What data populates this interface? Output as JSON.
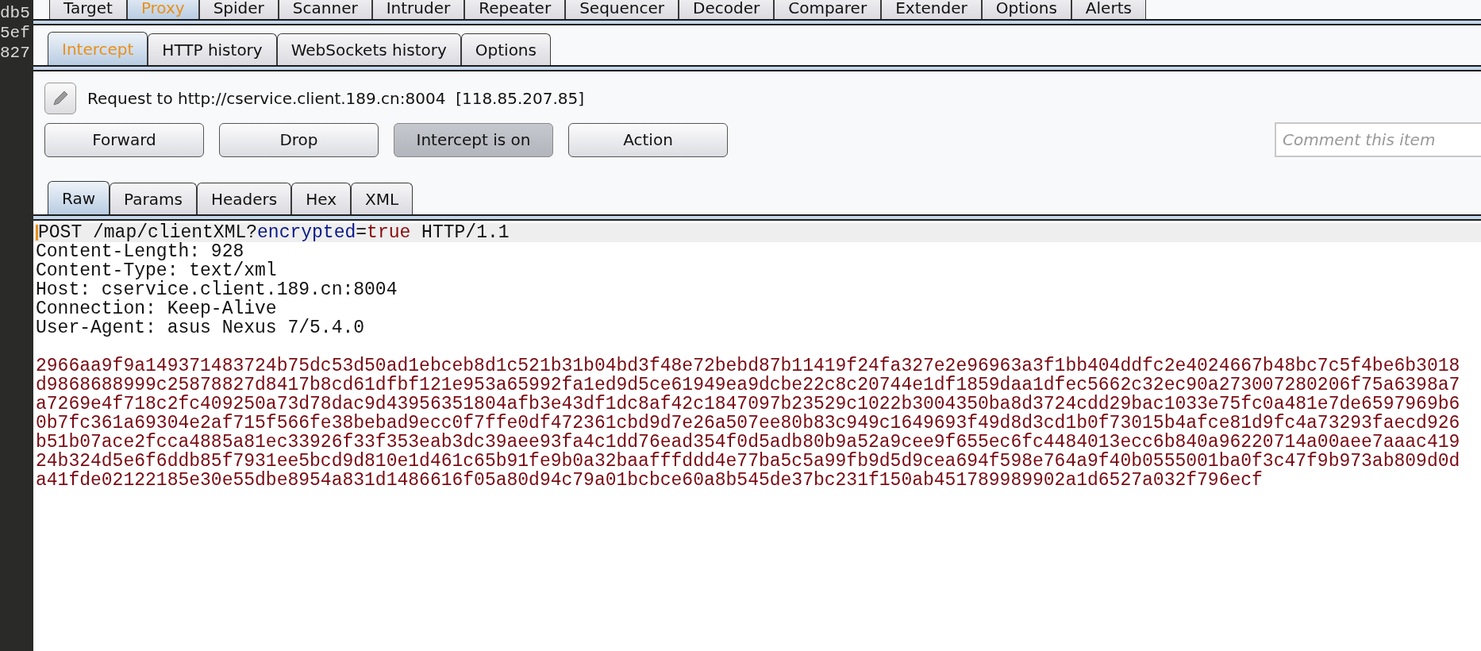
{
  "left_gutter": {
    "lines": [
      "db5",
      "5ef",
      "827"
    ]
  },
  "main_tabs": [
    {
      "label": "Target",
      "selected": false
    },
    {
      "label": "Proxy",
      "selected": true
    },
    {
      "label": "Spider",
      "selected": false
    },
    {
      "label": "Scanner",
      "selected": false
    },
    {
      "label": "Intruder",
      "selected": false
    },
    {
      "label": "Repeater",
      "selected": false
    },
    {
      "label": "Sequencer",
      "selected": false
    },
    {
      "label": "Decoder",
      "selected": false
    },
    {
      "label": "Comparer",
      "selected": false
    },
    {
      "label": "Extender",
      "selected": false
    },
    {
      "label": "Options",
      "selected": false
    },
    {
      "label": "Alerts",
      "selected": false
    }
  ],
  "proxy_tabs": [
    {
      "label": "Intercept",
      "selected": true
    },
    {
      "label": "HTTP history",
      "selected": false
    },
    {
      "label": "WebSockets history",
      "selected": false
    },
    {
      "label": "Options",
      "selected": false
    }
  ],
  "request": {
    "title": "Request to http://cservice.client.189.cn:8004  [118.85.207.85]"
  },
  "actions": [
    {
      "label": "Forward",
      "pressed": false
    },
    {
      "label": "Drop",
      "pressed": false
    },
    {
      "label": "Intercept is on",
      "pressed": true
    },
    {
      "label": "Action",
      "pressed": false
    }
  ],
  "comment": {
    "placeholder": "Comment this item"
  },
  "message_tabs": [
    {
      "label": "Raw",
      "selected": true
    },
    {
      "label": "Params",
      "selected": false
    },
    {
      "label": "Headers",
      "selected": false
    },
    {
      "label": "Hex",
      "selected": false
    },
    {
      "label": "XML",
      "selected": false
    }
  ],
  "editor": {
    "request_line": [
      {
        "text": "POST /map/clientXML?",
        "kind": "plain"
      },
      {
        "text": "encrypted",
        "kind": "param-name"
      },
      {
        "text": "=",
        "kind": "plain"
      },
      {
        "text": "true",
        "kind": "param-value"
      },
      {
        "text": " HTTP/1.1",
        "kind": "plain"
      }
    ],
    "headers": [
      "Content-Length: 928",
      "Content-Type: text/xml",
      "Host: cservice.client.189.cn:8004",
      "Connection: Keep-Alive",
      "User-Agent: asus Nexus 7/5.4.0"
    ],
    "body": [
      "2966aa9f9a149371483724b75dc53d50ad1ebceb8d1c521b31b04bd3f48e72bebd87b11419f24fa327e2e96963a3f1bb404ddfc2e4024667b48bc7c5f4be6b3018",
      "d9868688999c25878827d8417b8cd61dfbf121e953a65992fa1ed9d5ce61949ea9dcbe22c8c20744e1df1859daa1dfec5662c32ec90a273007280206f75a6398a7",
      "a7269e4f718c2fc409250a73d78dac9d43956351804afb3e43df1dc8af42c1847097b23529c1022b3004350ba8d3724cdd29bac1033e75fc0a481e7de6597969b6",
      "0b7fc361a69304e2af715f566fe38bebad9ecc0f7ffe0df472361cbd9d7e26a507ee80b83c949c1649693f49d8d3cd1b0f73015b4afce81d9fc4a73293faecd926",
      "b51b07ace2fcca4885a81ec33926f33f353eab3dc39aee93fa4c1dd76ead354f0d5adb80b9a52a9cee9f655ec6fc4484013ecc6b840a96220714a00aee7aaac419",
      "24b324d5e6f6ddb85f7931ee5bcd9d810e1d461c65b91fe9b0a32baafffddd4e77ba5c5a99fb9d5d9cea694f598e764a9f40b0555001ba0f3c47f9b973ab809d0d",
      "a41fde02122185e30e55dbe8954a831d1486616f05a80d94c79a01bcbce60a8b545de37bc231f150ab451789989902a1d6527a032f796ecf"
    ]
  }
}
